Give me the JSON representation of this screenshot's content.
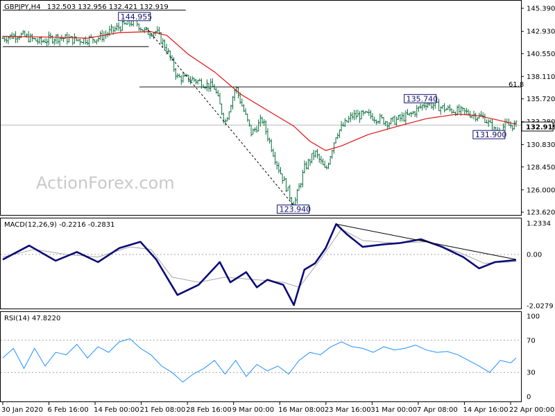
{
  "header": {
    "symbol": "GBPJPY,H4",
    "ohlc": "132.503 132.956 132.421 132.919"
  },
  "watermark": "ActionForex.com",
  "current_price": "132.919",
  "fib_label": "61.8",
  "colors": {
    "price_bars": "#0a6e3e",
    "sma": "#e01010",
    "macd": "#0a0a78",
    "macd_signal": "#a6a6a6",
    "rsi": "#1e90ff",
    "label_box": "#10106e",
    "grid_dash": "#a0a0a0"
  },
  "chart_data": [
    {
      "type": "line",
      "title": "GBPJPY,H4",
      "panel": "price",
      "y_ticks": [
        "145.390",
        "142.930",
        "140.550",
        "138.110",
        "135.720",
        "133.280",
        "130.830",
        "128.450",
        "126.000",
        "123.620"
      ],
      "ylim": [
        123.62,
        145.39
      ],
      "x_ticks": [
        "30 Jan 2020",
        "6 Feb 16:00",
        "14 Feb 00:00",
        "21 Feb 08:00",
        "28 Feb 16:00",
        "9 Mar 00:00",
        "16 Mar 08:00",
        "23 Mar 16:00",
        "31 Mar 00:00",
        "7 Apr 08:00",
        "14 Apr 16:00",
        "22 Apr 00:00"
      ],
      "price_keypoints": [
        {
          "t": 0,
          "v": 142.2
        },
        {
          "t": 3,
          "v": 142.6
        },
        {
          "t": 7,
          "v": 141.8
        },
        {
          "t": 10,
          "v": 142.3
        },
        {
          "t": 14,
          "v": 142.0
        },
        {
          "t": 18,
          "v": 142.2
        },
        {
          "t": 22,
          "v": 143.4
        },
        {
          "t": 25,
          "v": 144.0
        },
        {
          "t": 27,
          "v": 142.8
        },
        {
          "t": 29,
          "v": 142.9
        },
        {
          "t": 31,
          "v": 141.0
        },
        {
          "t": 33,
          "v": 138.0
        },
        {
          "t": 36,
          "v": 137.8
        },
        {
          "t": 40,
          "v": 136.9
        },
        {
          "t": 42,
          "v": 133.2
        },
        {
          "t": 44,
          "v": 137.0
        },
        {
          "t": 47,
          "v": 132.0
        },
        {
          "t": 49,
          "v": 133.5
        },
        {
          "t": 52,
          "v": 128.5
        },
        {
          "t": 55,
          "v": 124.3
        },
        {
          "t": 57,
          "v": 128.3
        },
        {
          "t": 59,
          "v": 130.0
        },
        {
          "t": 61,
          "v": 128.0
        },
        {
          "t": 63,
          "v": 132.0
        },
        {
          "t": 66,
          "v": 133.9
        },
        {
          "t": 69,
          "v": 134.0
        },
        {
          "t": 73,
          "v": 133.2
        },
        {
          "t": 77,
          "v": 134.0
        },
        {
          "t": 80,
          "v": 135.3
        },
        {
          "t": 84,
          "v": 134.6
        },
        {
          "t": 88,
          "v": 134.2
        },
        {
          "t": 91,
          "v": 133.7
        },
        {
          "t": 93,
          "v": 132.2
        },
        {
          "t": 95,
          "v": 132.9
        },
        {
          "t": 97,
          "v": 132.9
        }
      ],
      "moving_average": [
        {
          "t": 0,
          "v": 142.4
        },
        {
          "t": 10,
          "v": 142.3
        },
        {
          "t": 16,
          "v": 142.2
        },
        {
          "t": 22,
          "v": 142.8
        },
        {
          "t": 28,
          "v": 142.9
        },
        {
          "t": 31,
          "v": 142.5
        },
        {
          "t": 35,
          "v": 140.5
        },
        {
          "t": 40,
          "v": 138.6
        },
        {
          "t": 45,
          "v": 136.2
        },
        {
          "t": 50,
          "v": 134.5
        },
        {
          "t": 55,
          "v": 132.8
        },
        {
          "t": 58,
          "v": 131.2
        },
        {
          "t": 61,
          "v": 130.2
        },
        {
          "t": 64,
          "v": 130.7
        },
        {
          "t": 69,
          "v": 131.9
        },
        {
          "t": 74,
          "v": 132.7
        },
        {
          "t": 80,
          "v": 133.6
        },
        {
          "t": 86,
          "v": 134.1
        },
        {
          "t": 90,
          "v": 133.9
        },
        {
          "t": 94,
          "v": 133.4
        },
        {
          "t": 97,
          "v": 133.0
        }
      ],
      "annotations": [
        {
          "label": "144.955",
          "t": 25,
          "v": 144.96
        },
        {
          "label": "123.940",
          "t": 55,
          "v": 123.94
        },
        {
          "label": "135.740",
          "t": 79,
          "v": 135.74
        },
        {
          "label": "131.900",
          "t": 92,
          "v": 131.9
        }
      ],
      "horizontal_levels": [
        {
          "label": "61.8",
          "v": 137.0
        }
      ],
      "support_resistance_lines": [
        {
          "t0": 0,
          "t1": 33,
          "v": 145.2
        },
        {
          "t0": 0,
          "t1": 26,
          "v": 141.3
        }
      ],
      "trend_line": [
        {
          "t": 27,
          "v": 143.4
        },
        {
          "t": 55,
          "v": 124.3
        }
      ]
    },
    {
      "type": "line",
      "title": "MACD(12,26,9) -0.2216 -0.2831",
      "panel": "macd",
      "y_ticks": [
        "1.2334",
        "0.00",
        "-2.0279"
      ],
      "ylim": [
        -2.0279,
        1.2334
      ],
      "macd": [
        {
          "t": 0,
          "v": -0.2
        },
        {
          "t": 5,
          "v": 0.35
        },
        {
          "t": 10,
          "v": -0.25
        },
        {
          "t": 14,
          "v": 0.1
        },
        {
          "t": 18,
          "v": -0.3
        },
        {
          "t": 22,
          "v": 0.25
        },
        {
          "t": 26,
          "v": 0.5
        },
        {
          "t": 29,
          "v": -0.2
        },
        {
          "t": 33,
          "v": -1.6
        },
        {
          "t": 37,
          "v": -1.2
        },
        {
          "t": 41,
          "v": -0.3
        },
        {
          "t": 43,
          "v": -1.1
        },
        {
          "t": 46,
          "v": -0.7
        },
        {
          "t": 48,
          "v": -1.3
        },
        {
          "t": 50,
          "v": -1.0
        },
        {
          "t": 53,
          "v": -1.2
        },
        {
          "t": 55,
          "v": -2.0
        },
        {
          "t": 57,
          "v": -0.6
        },
        {
          "t": 59,
          "v": -0.35
        },
        {
          "t": 61,
          "v": 0.25
        },
        {
          "t": 63,
          "v": 1.2
        },
        {
          "t": 65,
          "v": 0.8
        },
        {
          "t": 68,
          "v": 0.3
        },
        {
          "t": 72,
          "v": 0.4
        },
        {
          "t": 75,
          "v": 0.45
        },
        {
          "t": 79,
          "v": 0.6
        },
        {
          "t": 83,
          "v": 0.3
        },
        {
          "t": 87,
          "v": -0.1
        },
        {
          "t": 90,
          "v": -0.55
        },
        {
          "t": 93,
          "v": -0.3
        },
        {
          "t": 97,
          "v": -0.22
        }
      ],
      "signal": [
        {
          "t": 0,
          "v": -0.1
        },
        {
          "t": 6,
          "v": 0.2
        },
        {
          "t": 12,
          "v": 0.0
        },
        {
          "t": 18,
          "v": -0.1
        },
        {
          "t": 24,
          "v": 0.3
        },
        {
          "t": 28,
          "v": 0.2
        },
        {
          "t": 32,
          "v": -0.9
        },
        {
          "t": 37,
          "v": -1.1
        },
        {
          "t": 42,
          "v": -0.9
        },
        {
          "t": 48,
          "v": -1.0
        },
        {
          "t": 53,
          "v": -1.1
        },
        {
          "t": 56,
          "v": -1.3
        },
        {
          "t": 60,
          "v": -0.2
        },
        {
          "t": 64,
          "v": 1.0
        },
        {
          "t": 68,
          "v": 0.55
        },
        {
          "t": 74,
          "v": 0.45
        },
        {
          "t": 80,
          "v": 0.5
        },
        {
          "t": 86,
          "v": 0.1
        },
        {
          "t": 91,
          "v": -0.35
        },
        {
          "t": 97,
          "v": -0.28
        }
      ],
      "trend_line": [
        {
          "t": 63,
          "v": 1.2
        },
        {
          "t": 97,
          "v": -0.2
        }
      ]
    },
    {
      "type": "line",
      "title": "RSI(14) 47.8220",
      "panel": "rsi",
      "y_ticks": [
        "100",
        "70",
        "30",
        "0"
      ],
      "ylim": [
        0,
        100
      ],
      "levels": [
        70,
        30
      ],
      "rsi": [
        {
          "t": 0,
          "v": 48
        },
        {
          "t": 2,
          "v": 60
        },
        {
          "t": 4,
          "v": 35
        },
        {
          "t": 6,
          "v": 60
        },
        {
          "t": 8,
          "v": 38
        },
        {
          "t": 10,
          "v": 55
        },
        {
          "t": 12,
          "v": 52
        },
        {
          "t": 14,
          "v": 65
        },
        {
          "t": 16,
          "v": 48
        },
        {
          "t": 18,
          "v": 62
        },
        {
          "t": 20,
          "v": 55
        },
        {
          "t": 22,
          "v": 68
        },
        {
          "t": 24,
          "v": 72
        },
        {
          "t": 26,
          "v": 60
        },
        {
          "t": 28,
          "v": 52
        },
        {
          "t": 30,
          "v": 38
        },
        {
          "t": 32,
          "v": 30
        },
        {
          "t": 34,
          "v": 18
        },
        {
          "t": 36,
          "v": 28
        },
        {
          "t": 38,
          "v": 35
        },
        {
          "t": 40,
          "v": 45
        },
        {
          "t": 42,
          "v": 28
        },
        {
          "t": 44,
          "v": 45
        },
        {
          "t": 46,
          "v": 25
        },
        {
          "t": 48,
          "v": 40
        },
        {
          "t": 50,
          "v": 32
        },
        {
          "t": 52,
          "v": 38
        },
        {
          "t": 54,
          "v": 28
        },
        {
          "t": 56,
          "v": 45
        },
        {
          "t": 58,
          "v": 55
        },
        {
          "t": 60,
          "v": 52
        },
        {
          "t": 62,
          "v": 62
        },
        {
          "t": 64,
          "v": 68
        },
        {
          "t": 66,
          "v": 62
        },
        {
          "t": 68,
          "v": 60
        },
        {
          "t": 70,
          "v": 55
        },
        {
          "t": 72,
          "v": 62
        },
        {
          "t": 74,
          "v": 58
        },
        {
          "t": 76,
          "v": 60
        },
        {
          "t": 78,
          "v": 64
        },
        {
          "t": 80,
          "v": 58
        },
        {
          "t": 82,
          "v": 55
        },
        {
          "t": 84,
          "v": 56
        },
        {
          "t": 86,
          "v": 52
        },
        {
          "t": 88,
          "v": 45
        },
        {
          "t": 90,
          "v": 38
        },
        {
          "t": 92,
          "v": 30
        },
        {
          "t": 94,
          "v": 45
        },
        {
          "t": 96,
          "v": 42
        },
        {
          "t": 97,
          "v": 48
        }
      ]
    }
  ]
}
